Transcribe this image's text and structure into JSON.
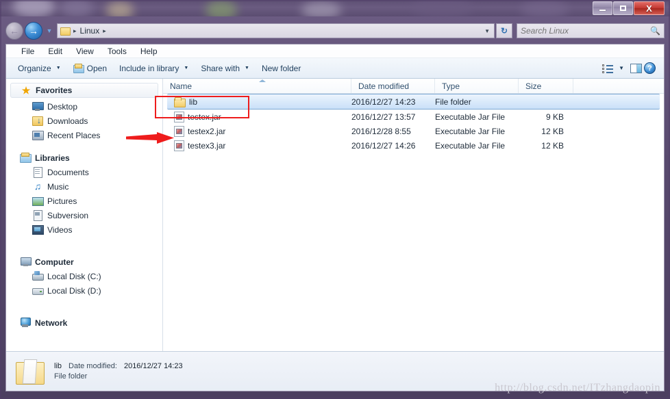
{
  "window": {
    "controls": {
      "minimize_label": "–",
      "maximize_label": "",
      "close_label": "X"
    }
  },
  "address_bar": {
    "back_label": "←",
    "forward_label": "→",
    "history_label": "▼",
    "folder_icon": "folder-icon",
    "breadcrumb": [
      "Linux"
    ],
    "separator": "▸",
    "dropdown_label": "▼",
    "refresh_label": "↻"
  },
  "search": {
    "placeholder": "Search Linux",
    "value": "",
    "icon": "magnifier-icon"
  },
  "menubar": {
    "items": [
      {
        "label": "File"
      },
      {
        "label": "Edit"
      },
      {
        "label": "View"
      },
      {
        "label": "Tools"
      },
      {
        "label": "Help"
      }
    ]
  },
  "toolbar": {
    "organize_label": "Organize",
    "open_label": "Open",
    "include_label": "Include in library",
    "share_label": "Share with",
    "newfolder_label": "New folder",
    "caret": "▼",
    "view_icon": "view-options-icon",
    "view_caret": "▼",
    "preview_icon": "preview-pane-icon",
    "help_icon": "help-icon",
    "help_glyph": "?"
  },
  "sidebar": {
    "groups": [
      {
        "name": "Favorites",
        "label": "Favorites",
        "icon": "star-icon",
        "items": [
          {
            "label": "Desktop",
            "icon": "desktop-icon"
          },
          {
            "label": "Downloads",
            "icon": "downloads-icon"
          },
          {
            "label": "Recent Places",
            "icon": "recent-places-icon"
          }
        ]
      },
      {
        "name": "Libraries",
        "label": "Libraries",
        "icon": "libraries-icon",
        "items": [
          {
            "label": "Documents",
            "icon": "documents-icon"
          },
          {
            "label": "Music",
            "icon": "music-icon"
          },
          {
            "label": "Pictures",
            "icon": "pictures-icon"
          },
          {
            "label": "Subversion",
            "icon": "subversion-icon"
          },
          {
            "label": "Videos",
            "icon": "videos-icon"
          }
        ]
      },
      {
        "name": "Computer",
        "label": "Computer",
        "icon": "computer-icon",
        "items": [
          {
            "label": "Local Disk (C:)",
            "icon": "local-disk-c-icon"
          },
          {
            "label": "Local Disk (D:)",
            "icon": "local-disk-d-icon"
          }
        ]
      },
      {
        "name": "Network",
        "label": "Network",
        "icon": "network-icon",
        "items": []
      }
    ]
  },
  "filelist": {
    "columns": [
      {
        "key": "name",
        "label": "Name"
      },
      {
        "key": "date",
        "label": "Date modified"
      },
      {
        "key": "type",
        "label": "Type"
      },
      {
        "key": "size",
        "label": "Size"
      }
    ],
    "sort": {
      "column": "Name",
      "direction": "ascending"
    },
    "rows": [
      {
        "name": "lib",
        "date": "2016/12/27 14:23",
        "type": "File folder",
        "size": "",
        "icon": "folder-icon",
        "selected": true
      },
      {
        "name": "testex.jar",
        "date": "2016/12/27 13:57",
        "type": "Executable Jar File",
        "size": "9 KB",
        "icon": "jar-file-icon",
        "selected": false
      },
      {
        "name": "testex2.jar",
        "date": "2016/12/28 8:55",
        "type": "Executable Jar File",
        "size": "12 KB",
        "icon": "jar-file-icon",
        "selected": false
      },
      {
        "name": "testex3.jar",
        "date": "2016/12/27 14:26",
        "type": "Executable Jar File",
        "size": "12 KB",
        "icon": "jar-file-icon",
        "selected": false
      }
    ]
  },
  "details_pane": {
    "item_name": "lib",
    "item_type": "File folder",
    "date_label": "Date modified:",
    "date_value": "2016/12/27 14:23",
    "icon": "large-folder-icon"
  },
  "annotations": {
    "highlight_color": "#ee1c1c",
    "rectangle_target": "lib",
    "arrow_target": "testex2.jar"
  },
  "watermark": {
    "text": "http://blog.csdn.net/ITzhangdaopin"
  }
}
